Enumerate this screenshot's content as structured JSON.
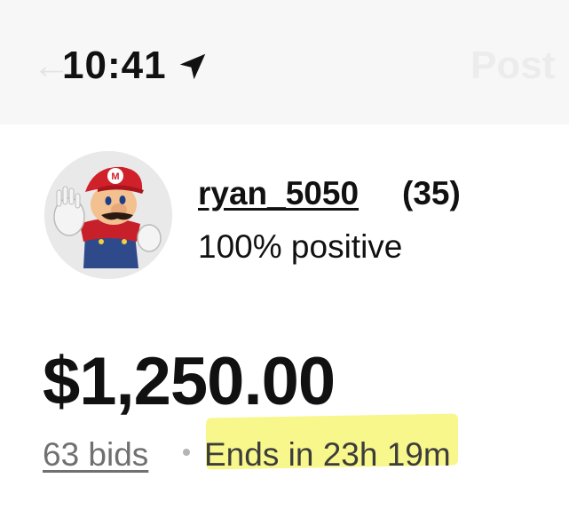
{
  "status_bar": {
    "time": "10:41",
    "location_icon": "location-arrow-icon",
    "back_icon": "back-arrow-icon",
    "nav_right_label": "Post"
  },
  "seller": {
    "username": "ryan_5050",
    "feedback_count": "(35)",
    "feedback_percent": "100% positive",
    "avatar_icon": "seller-avatar"
  },
  "listing": {
    "price": "$1,250.00",
    "bids": "63 bids",
    "separator": "•",
    "ends_in": "Ends in 23h 19m"
  },
  "colors": {
    "highlight": "#f7f78b",
    "status_bg": "#f7f7f7",
    "muted_text": "#707070"
  }
}
